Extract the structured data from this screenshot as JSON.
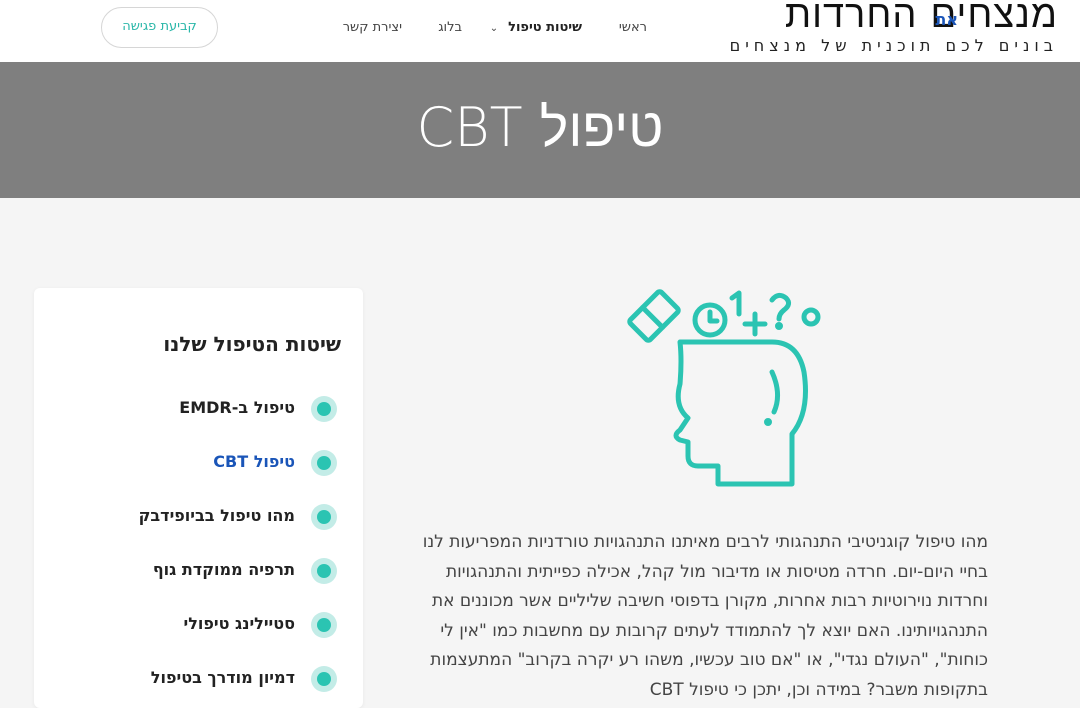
{
  "header": {
    "logo": {
      "main": "מנצחים החרדות",
      "accent": "את",
      "tagline": "בונים לכם תוכנית של מנצחים"
    },
    "nav": [
      {
        "label": "ראשי"
      },
      {
        "label": "שיטות טיפול",
        "chevron": "⌄"
      },
      {
        "label": "בלוג"
      },
      {
        "label": "יצירת קשר"
      }
    ],
    "cta": "קביעת פגישה"
  },
  "hero": {
    "title": "טיפול CBT"
  },
  "sidebar": {
    "title": "שיטות הטיפול שלנו",
    "items": [
      {
        "label": "טיפול ב-EMDR"
      },
      {
        "label": "טיפול CBT",
        "current": true
      },
      {
        "label": "מהו טיפול בביופידבק"
      },
      {
        "label": "תרפיה ממוקדת גוף"
      },
      {
        "label": "סטיילינג טיפולי"
      },
      {
        "label": "דמיון מודרך בטיפול"
      }
    ]
  },
  "content": {
    "paragraph": "מהו טיפול קוגניטיבי התנהגותי לרבים מאיתנו התנהגויות טורדניות המפריעות לנו בחיי היום-יום. חרדה מטיסות או מדיבור מול קהל, אכילה כפייתית והתנהגויות וחרדות נוירוטיות רבות אחרות, מקורן בדפוסי חשיבה שליליים אשר מכוננים את התנהגויותינו. האם יוצא לך להתמודד לעתים קרובות עם מחשבות כמו \"אין לי כוחות\", \"העולם נגדי\", או \"אם טוב עכשיו, משהו רע יקרה בקרוב\" המתעצמות בתקופות משבר? במידה וכן, יתכן כי טיפול CBT"
  },
  "colors": {
    "accent_teal": "#2bc4b2",
    "link_blue": "#1a55b8",
    "hero_bg": "#7f7f7f"
  },
  "icons": {
    "illustration": "head-thoughts-icon"
  }
}
